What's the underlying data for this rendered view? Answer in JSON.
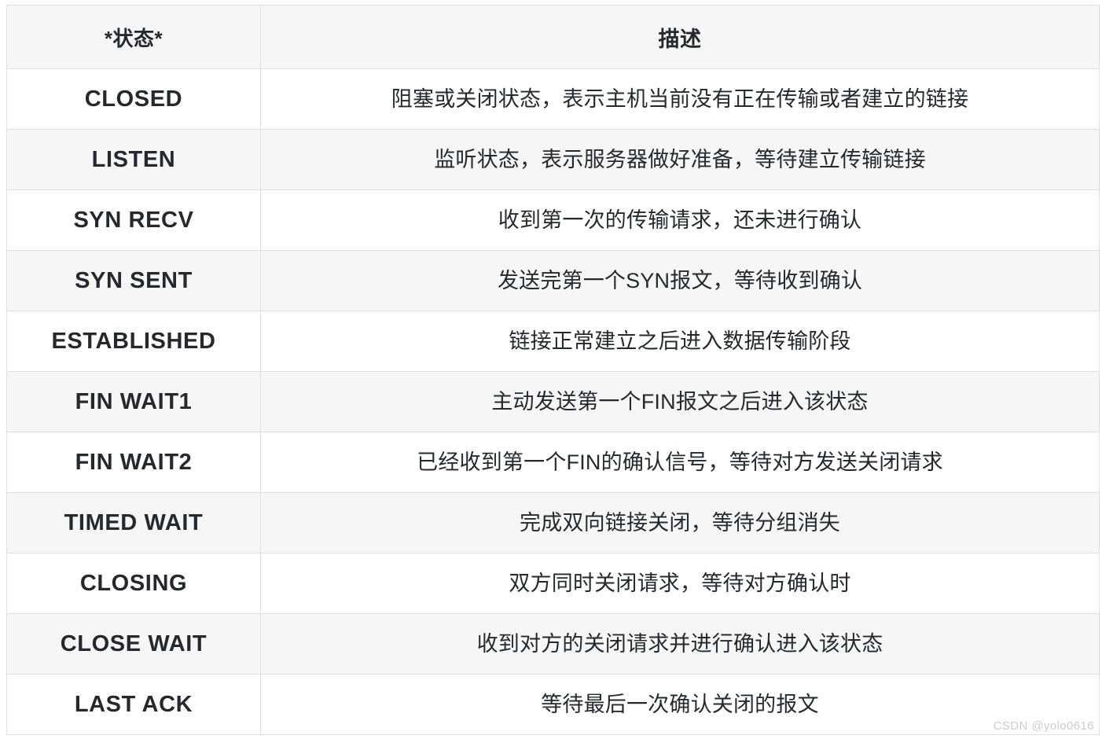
{
  "table": {
    "columns": [
      {
        "key": "state",
        "label": "*状态*"
      },
      {
        "key": "description",
        "label": "描述"
      }
    ],
    "rows": [
      {
        "state": "CLOSED",
        "description": "阻塞或关闭状态，表示主机当前没有正在传输或者建立的链接"
      },
      {
        "state": "LISTEN",
        "description": "监听状态，表示服务器做好准备，等待建立传输链接"
      },
      {
        "state": "SYN RECV",
        "description": "收到第一次的传输请求，还未进行确认"
      },
      {
        "state": "SYN SENT",
        "description": "发送完第一个SYN报文，等待收到确认"
      },
      {
        "state": "ESTABLISHED",
        "description": "链接正常建立之后进入数据传输阶段"
      },
      {
        "state": "FIN WAIT1",
        "description": "主动发送第一个FIN报文之后进入该状态"
      },
      {
        "state": "FIN WAIT2",
        "description": "已经收到第一个FIN的确认信号，等待对方发送关闭请求"
      },
      {
        "state": "TIMED WAIT",
        "description": "完成双向链接关闭，等待分组消失"
      },
      {
        "state": "CLOSING",
        "description": "双方同时关闭请求，等待对方确认时"
      },
      {
        "state": "CLOSE WAIT",
        "description": "收到对方的关闭请求并进行确认进入该状态"
      },
      {
        "state": "LAST ACK",
        "description": "等待最后一次确认关闭的报文"
      }
    ]
  },
  "watermark": {
    "text": "CSDN @yolo0616"
  },
  "colors": {
    "border": "#dde1e4",
    "header_bg": "#f6f6f7",
    "row_odd_bg": "#ffffff",
    "row_even_bg": "#f6f6f7",
    "text": "#23272c",
    "watermark": "#c9cdd2"
  }
}
